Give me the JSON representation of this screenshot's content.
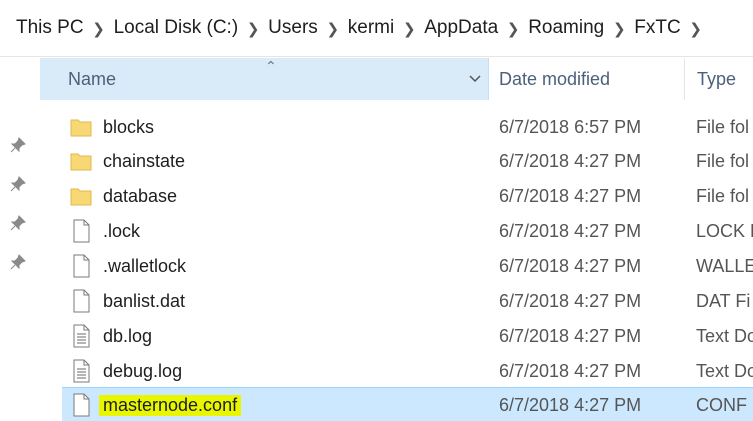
{
  "breadcrumb": [
    "This PC",
    "Local Disk (C:)",
    "Users",
    "kermi",
    "AppData",
    "Roaming",
    "FxTC"
  ],
  "columns": {
    "name": "Name",
    "date_modified": "Date modified",
    "type": "Type"
  },
  "files": [
    {
      "name": "blocks",
      "date": "6/7/2018 6:57 PM",
      "type": "File fol",
      "icon": "folder-icon"
    },
    {
      "name": "chainstate",
      "date": "6/7/2018 4:27 PM",
      "type": "File fol",
      "icon": "folder-icon"
    },
    {
      "name": "database",
      "date": "6/7/2018 4:27 PM",
      "type": "File fol",
      "icon": "folder-icon"
    },
    {
      "name": ".lock",
      "date": "6/7/2018 4:27 PM",
      "type": "LOCK F",
      "icon": "blank-file-icon"
    },
    {
      "name": ".walletlock",
      "date": "6/7/2018 4:27 PM",
      "type": "WALLE",
      "icon": "blank-file-icon"
    },
    {
      "name": "banlist.dat",
      "date": "6/7/2018 4:27 PM",
      "type": "DAT Fi",
      "icon": "blank-file-icon"
    },
    {
      "name": "db.log",
      "date": "6/7/2018 4:27 PM",
      "type": "Text Do",
      "icon": "text-file-icon"
    },
    {
      "name": "debug.log",
      "date": "6/7/2018 4:27 PM",
      "type": "Text Do",
      "icon": "text-file-icon"
    },
    {
      "name": "masternode.conf",
      "date": "6/7/2018 4:27 PM",
      "type": "CONF",
      "icon": "conf-file-icon",
      "selected": true,
      "highlighted": true
    }
  ],
  "colors": {
    "selection": "#cce8ff",
    "header": "#d9ebf9",
    "highlight": "#e8f700",
    "folder": "#f8d775"
  }
}
